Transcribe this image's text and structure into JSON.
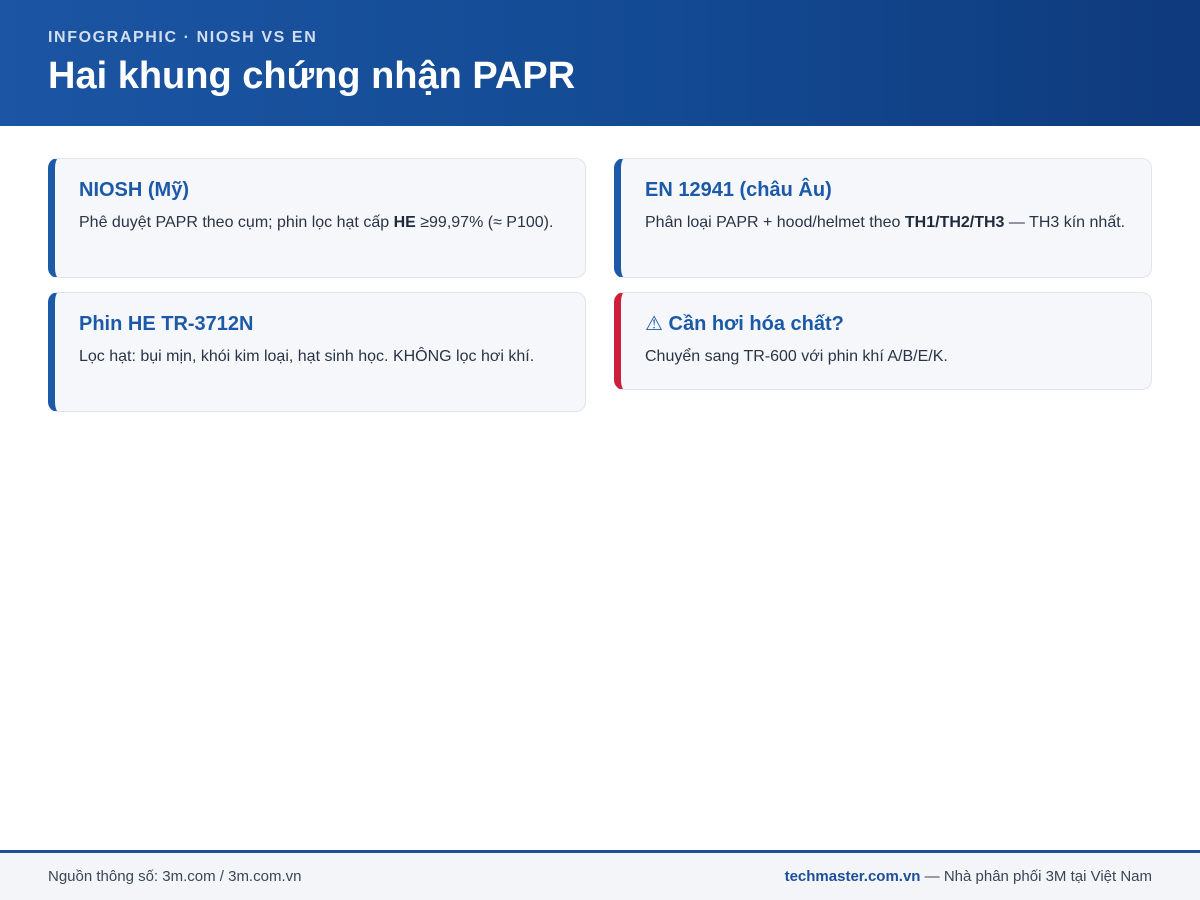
{
  "header": {
    "kicker": "INFOGRAPHIC · NIOSH VS EN",
    "title": "Hai khung chứng nhận PAPR"
  },
  "cards": [
    {
      "title": "NIOSH (Mỹ)",
      "text_before": "Phê duyệt PAPR theo cụm; phin lọc hạt cấp ",
      "bold": "HE",
      "text_after": " ≥99,97% (≈ P100)."
    },
    {
      "title": "EN 12941 (châu Âu)",
      "text_before": "Phân loại PAPR + hood/helmet theo ",
      "bold": "TH1/TH2/TH3",
      "text_after": " — TH3 kín nhất."
    },
    {
      "title": "Phin HE TR-3712N",
      "text": "Lọc hạt: bụi mịn, khói kim loại, hạt sinh học. KHÔNG lọc hơi khí."
    },
    {
      "icon": "warning-icon",
      "title": "Cần hơi hóa chất?",
      "text": "Chuyển sang TR-600 với phin khí A/B/E/K."
    }
  ],
  "footer": {
    "source": "Nguồn thông số: 3m.com / 3m.com.vn",
    "brand": "techmaster.com.vn",
    "tagline": " — Nhà phân phối 3M tại Việt Nam"
  },
  "colors": {
    "header_bg": "#134a93",
    "accent": "#1c5aa8",
    "warning_accent": "#cc1f3b"
  }
}
